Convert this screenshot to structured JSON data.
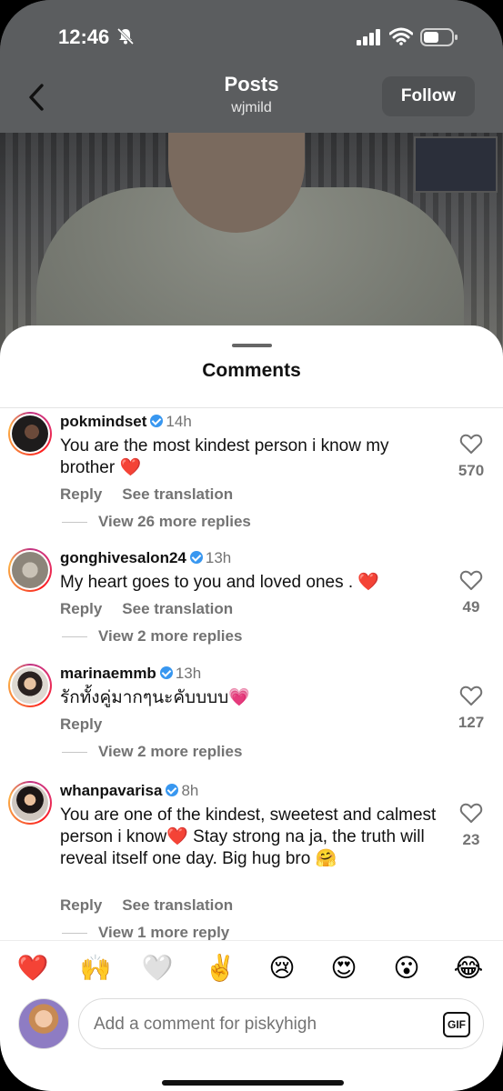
{
  "status_bar": {
    "time": "12:46"
  },
  "header": {
    "title": "Posts",
    "username": "wjmild",
    "follow_label": "Follow"
  },
  "sheet": {
    "title": "Comments"
  },
  "comments": [
    {
      "username": "pokmindset",
      "time": "14h",
      "text": "You are the most kindest person i know my brother ❤️",
      "reply_label": "Reply",
      "translation_label": "See translation",
      "replies_label": "View 26 more replies",
      "likes": "570"
    },
    {
      "username": "gonghivesalon24",
      "time": "13h",
      "text": "My heart goes to you and loved ones . ❤️",
      "reply_label": "Reply",
      "translation_label": "See translation",
      "replies_label": "View 2 more replies",
      "likes": "49"
    },
    {
      "username": "marinaemmb",
      "time": "13h",
      "text": "รักทั้งคู่มากๆนะคับบบบ💗",
      "reply_label": "Reply",
      "replies_label": "View 2 more replies",
      "likes": "127"
    },
    {
      "username": "whanpavarisa",
      "time": "8h",
      "text": "You are one of the kindest, sweetest and calmest person i know❤️ Stay strong na ja, the truth will reveal itself one day. Big hug bro 🤗",
      "reply_label": "Reply",
      "translation_label": "See translation",
      "replies_label": "View 1 more reply",
      "likes": "23"
    }
  ],
  "emoji_bar": [
    "❤️",
    "🙌",
    "🤍",
    "✌️",
    "😢",
    "😍",
    "😮",
    "😂"
  ],
  "composer": {
    "placeholder": "Add a comment for piskyhigh",
    "gif_label": "GIF"
  },
  "colors": {
    "accent_verified": "#3897f0",
    "muted": "#737373"
  }
}
